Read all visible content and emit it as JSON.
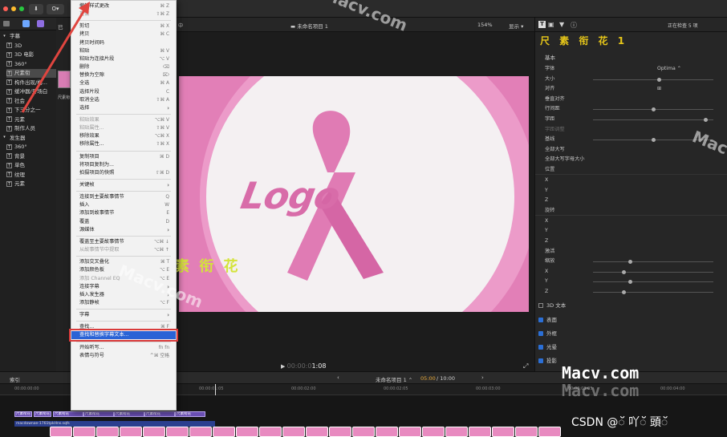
{
  "toolbar": {
    "import_icon": "download-icon",
    "keyword_label": "O▾",
    "project_title": "未命名项目 1",
    "zoom": "154%",
    "display": "显示 ▾",
    "inspector_status": "正在检查 5 项",
    "browser_label": "已"
  },
  "sidebar": {
    "items": [
      {
        "label": "字幕",
        "indent": 0,
        "expanded": true
      },
      {
        "label": "3D",
        "indent": 1
      },
      {
        "label": "3D 电影",
        "indent": 1
      },
      {
        "label": "360°",
        "indent": 1
      },
      {
        "label": "尺素衔",
        "indent": 1,
        "selected": true
      },
      {
        "label": "构件出现/构...",
        "indent": 1
      },
      {
        "label": "缓冲器/开场白",
        "indent": 1
      },
      {
        "label": "社会",
        "indent": 1
      },
      {
        "label": "下三分之一",
        "indent": 1
      },
      {
        "label": "元素",
        "indent": 1
      },
      {
        "label": "制作人员",
        "indent": 1
      },
      {
        "label": "发生器",
        "indent": 0,
        "expanded": true
      },
      {
        "label": "360°",
        "indent": 1
      },
      {
        "label": "背景",
        "indent": 1
      },
      {
        "label": "单色",
        "indent": 1
      },
      {
        "label": "纹理",
        "indent": 1
      },
      {
        "label": "元素",
        "indent": 1
      }
    ],
    "browser_thumb_label": "尺素衔"
  },
  "menu": {
    "items": [
      {
        "label": "撤销样式更改",
        "shortcut": "⌘ Z"
      },
      {
        "label": "重做",
        "shortcut": "⇧⌘ Z",
        "disabled": true
      },
      {
        "sep": true
      },
      {
        "label": "剪切",
        "shortcut": "⌘ X"
      },
      {
        "label": "拷贝",
        "shortcut": "⌘ C"
      },
      {
        "label": "拷贝时间码",
        "shortcut": ""
      },
      {
        "label": "粘贴",
        "shortcut": "⌘ V"
      },
      {
        "label": "粘贴为连接片段",
        "shortcut": "⌥ V"
      },
      {
        "label": "删除",
        "shortcut": "⌫"
      },
      {
        "label": "替换为空隙",
        "shortcut": "⌦"
      },
      {
        "label": "全选",
        "shortcut": "⌘ A"
      },
      {
        "label": "选择片段",
        "shortcut": "C"
      },
      {
        "label": "取消全选",
        "shortcut": "⇧⌘ A"
      },
      {
        "label": "选择",
        "shortcut": "",
        "arrow": true
      },
      {
        "sep": true
      },
      {
        "label": "粘贴效果",
        "shortcut": "⌥⌘ V",
        "disabled": true
      },
      {
        "label": "粘贴属性...",
        "shortcut": "⇧⌘ V",
        "disabled": true
      },
      {
        "label": "移除效果",
        "shortcut": "⌥⌘ X"
      },
      {
        "label": "移除属性...",
        "shortcut": "⇧⌘ X"
      },
      {
        "sep": true
      },
      {
        "label": "复制项目",
        "shortcut": "⌘ D"
      },
      {
        "label": "将项目复制为...",
        "shortcut": ""
      },
      {
        "label": "拍摄项目的快照",
        "shortcut": "⇧⌘ D"
      },
      {
        "sep": true
      },
      {
        "label": "关键帧",
        "shortcut": "",
        "arrow": true
      },
      {
        "sep": true
      },
      {
        "label": "连接到主要故事情节",
        "shortcut": "Q"
      },
      {
        "label": "插入",
        "shortcut": "W"
      },
      {
        "label": "添加到故事情节",
        "shortcut": "E"
      },
      {
        "label": "覆盖",
        "shortcut": "D"
      },
      {
        "label": "源媒体",
        "shortcut": "",
        "arrow": true
      },
      {
        "sep": true
      },
      {
        "label": "覆盖至主要故事情节",
        "shortcut": "⌥⌘ ↓"
      },
      {
        "label": "从故事情节中提取",
        "shortcut": "⌥⌘ ↑",
        "disabled": true
      },
      {
        "sep": true
      },
      {
        "label": "添加交叉叠化",
        "shortcut": "⌘ T"
      },
      {
        "label": "添加颜色板",
        "shortcut": "⌥ E"
      },
      {
        "label": "添加 Channel EQ",
        "shortcut": "⌥ E",
        "disabled": true
      },
      {
        "label": "连接字幕",
        "shortcut": "",
        "arrow": true
      },
      {
        "label": "插入发生器",
        "shortcut": "",
        "arrow": true
      },
      {
        "label": "添加静帧",
        "shortcut": "⌥ F"
      },
      {
        "sep": true
      },
      {
        "label": "字幕",
        "shortcut": "",
        "arrow": true
      },
      {
        "sep": true
      },
      {
        "label": "查找...",
        "shortcut": "⌘ F"
      },
      {
        "label": "查找和替换字幕文本...",
        "shortcut": "",
        "highlighted": true
      },
      {
        "sep": true
      },
      {
        "label": "开始听写...",
        "shortcut": "fn fn"
      },
      {
        "label": "表情与符号",
        "shortcut": "^⌘ 空格"
      }
    ]
  },
  "viewer": {
    "logo_text": "Logo",
    "subtitle_text": "素 衔 花",
    "timecode_dim": "00:00:0",
    "timecode": "1:08",
    "play_icon": "play-icon"
  },
  "inspector": {
    "title": "尺 素 衔 花 1",
    "basic_section": "基本",
    "rows": [
      {
        "label": "字体",
        "value": "Optima ⌃"
      },
      {
        "label": "大小",
        "slider": 0.55
      },
      {
        "label": "对齐",
        "value": "⊞"
      },
      {
        "label": "垂直对齐",
        "value": ""
      },
      {
        "label": "行间距",
        "slider": 0.5
      },
      {
        "label": "字距",
        "slider": 0.95
      },
      {
        "label": "字距调整",
        "value": "",
        "disabled": true
      },
      {
        "label": "基线",
        "slider": 0.5
      },
      {
        "label": "全部大写",
        "value": ""
      },
      {
        "label": "全部大写字母大小",
        "value": ""
      },
      {
        "label": "位置",
        "section": true
      },
      {
        "label": "X",
        "value": ""
      },
      {
        "label": "Y",
        "value": ""
      },
      {
        "label": "Z",
        "value": ""
      },
      {
        "label": "旋转",
        "section": true
      },
      {
        "label": "X",
        "value": ""
      },
      {
        "label": "Y",
        "value": ""
      },
      {
        "label": "Z",
        "value": ""
      },
      {
        "label": "激活",
        "value": ""
      },
      {
        "label": "缩放",
        "slider": 0.3
      },
      {
        "label": "X",
        "slider": 0.25
      },
      {
        "label": "Y",
        "slider": 0.3
      },
      {
        "label": "Z",
        "slider": 0.25
      }
    ],
    "text3d_label": "3D 文本",
    "checks": [
      "表面",
      "外框",
      "光晕",
      "投影"
    ]
  },
  "timeline": {
    "index_label": "索引",
    "project_name": "未命名项目 1 ⌃",
    "duration_current": "05:00",
    "duration_total": "10:00",
    "ruler_marks": [
      "00:00:00:00",
      "00:00:01:00",
      "00:00:01:05",
      "00:00:02:00",
      "00:00:02:05",
      "00:00:03:00",
      "00:00:03:05",
      "00:00:04:00"
    ],
    "clip_labels": [
      "尺素衔花",
      "尺素衔花",
      "尺素衔花",
      "尺素衔花",
      "尺素衔花",
      "尺素衔花",
      "尺素衔花"
    ],
    "track_filename": "macdownae-1761tpkHns.sqfs",
    "highlight_color": "#d93a3a"
  },
  "watermarks": {
    "macv": "Macv.com",
    "csdn": "CSDN @ॅ 吖ॅ 頭ॅ",
    "brand": "Macv.com"
  },
  "colors": {
    "pink": "#e27fb7",
    "accent_blue": "#2a63d6",
    "title_yellow": "#e6c619"
  }
}
